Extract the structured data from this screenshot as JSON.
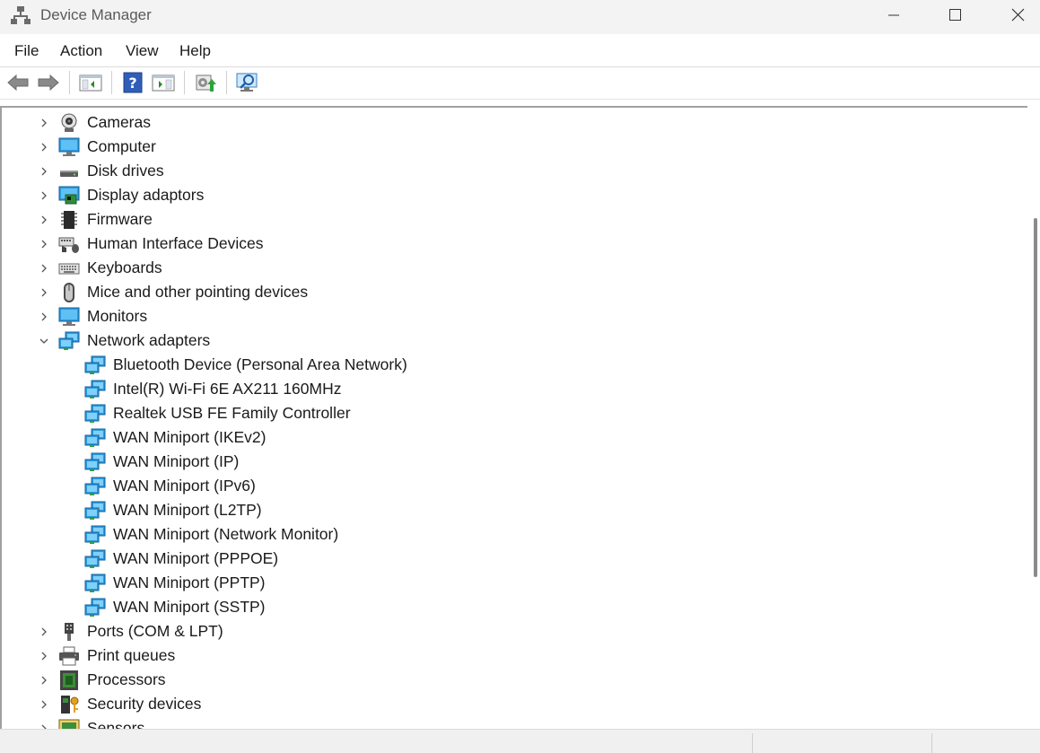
{
  "window": {
    "title": "Device Manager"
  },
  "menu": [
    "File",
    "Action",
    "View",
    "Help"
  ],
  "toolbar": {
    "buttons": [
      "back-arrow-icon",
      "forward-arrow-icon",
      "show-hide-console-tree-icon",
      "help-icon",
      "properties-pane-icon",
      "update-driver-icon",
      "scan-hardware-icon"
    ]
  },
  "tree": {
    "categories_top": [
      {
        "label": "Cameras",
        "icon": "camera-icon",
        "expanded": false
      },
      {
        "label": "Computer",
        "icon": "computer-icon",
        "expanded": false
      },
      {
        "label": "Disk drives",
        "icon": "disk-drive-icon",
        "expanded": false
      },
      {
        "label": "Display adaptors",
        "icon": "display-adapter-icon",
        "expanded": false
      },
      {
        "label": "Firmware",
        "icon": "firmware-icon",
        "expanded": false
      },
      {
        "label": "Human Interface Devices",
        "icon": "hid-icon",
        "expanded": false
      },
      {
        "label": "Keyboards",
        "icon": "keyboard-icon",
        "expanded": false
      },
      {
        "label": "Mice and other pointing devices",
        "icon": "mouse-icon",
        "expanded": false
      },
      {
        "label": "Monitors",
        "icon": "monitor-icon",
        "expanded": false
      },
      {
        "label": "Network adapters",
        "icon": "network-adapter-icon",
        "expanded": true
      }
    ],
    "network_children": [
      "Bluetooth Device (Personal Area Network)",
      "Intel(R) Wi-Fi 6E AX211 160MHz",
      "Realtek USB FE Family Controller",
      "WAN Miniport (IKEv2)",
      "WAN Miniport (IP)",
      "WAN Miniport (IPv6)",
      "WAN Miniport (L2TP)",
      "WAN Miniport (Network Monitor)",
      "WAN Miniport (PPPOE)",
      "WAN Miniport (PPTP)",
      "WAN Miniport (SSTP)"
    ],
    "categories_bottom": [
      {
        "label": "Ports (COM & LPT)",
        "icon": "port-icon",
        "expanded": false
      },
      {
        "label": "Print queues",
        "icon": "printer-icon",
        "expanded": false
      },
      {
        "label": "Processors",
        "icon": "processor-icon",
        "expanded": false
      },
      {
        "label": "Security devices",
        "icon": "security-device-icon",
        "expanded": false
      },
      {
        "label": "Sensors",
        "icon": "sensor-icon",
        "expanded": false
      }
    ]
  },
  "colors": {
    "accent": "#1e90d8",
    "titlebar": "#f3f3f3"
  }
}
